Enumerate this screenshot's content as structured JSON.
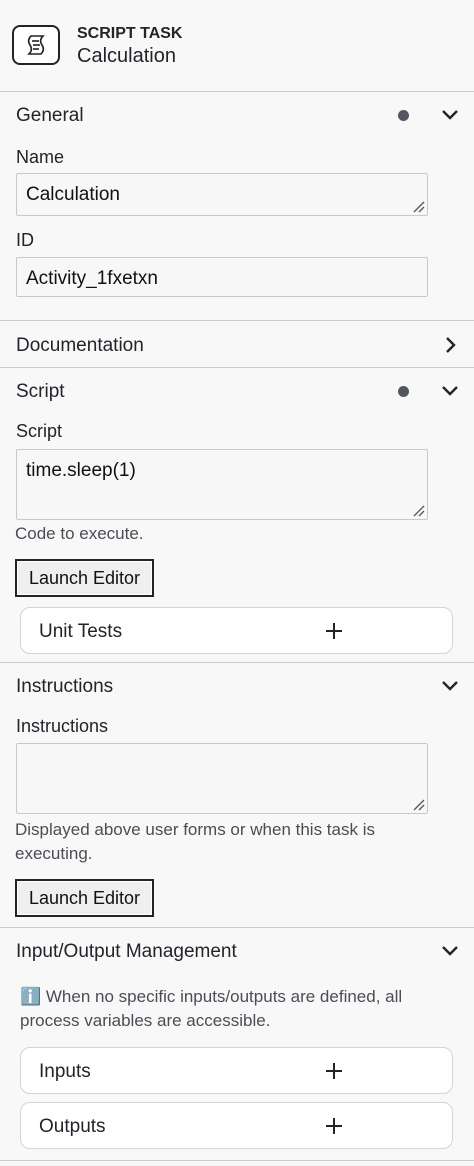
{
  "header": {
    "type": "SCRIPT TASK",
    "name": "Calculation",
    "icon": "script-task-icon"
  },
  "general": {
    "title": "General",
    "name_label": "Name",
    "name_value": "Calculation",
    "id_label": "ID",
    "id_value": "Activity_1fxetxn"
  },
  "documentation": {
    "title": "Documentation"
  },
  "script": {
    "title": "Script",
    "field_label": "Script",
    "value": "time.sleep(1)",
    "hint": "Code to execute.",
    "launch_label": "Launch Editor",
    "unit_tests_label": "Unit Tests"
  },
  "instructions": {
    "title": "Instructions",
    "field_label": "Instructions",
    "value": "",
    "hint": "Displayed above user forms or when this task is executing.",
    "launch_label": "Launch Editor"
  },
  "io": {
    "title": "Input/Output Management",
    "info": "ℹ️ When no specific inputs/outputs are defined, all process variables are accessible.",
    "inputs_label": "Inputs",
    "outputs_label": "Outputs"
  }
}
